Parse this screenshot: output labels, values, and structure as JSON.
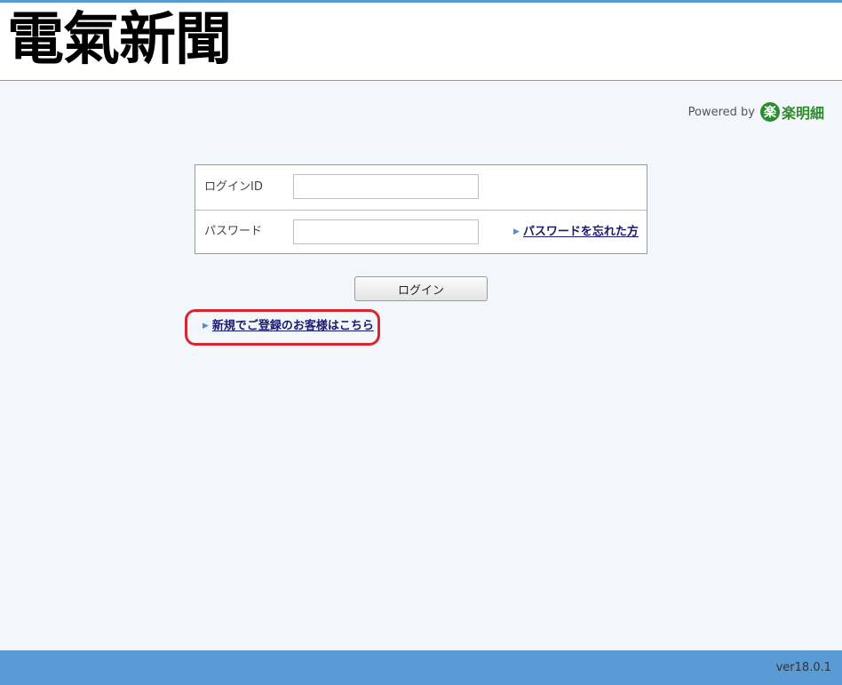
{
  "header": {
    "logo_text": "電氣新聞"
  },
  "powered": {
    "label": "Powered by",
    "brand_icon_char": "楽",
    "brand_icon": "rakumeisai-logo-icon",
    "brand_name": "楽明細"
  },
  "login_form": {
    "id_label": "ログインID",
    "id_value": "",
    "password_label": "パスワード",
    "password_value": "",
    "forgot_link": "パスワードを忘れた方"
  },
  "login_button": "ログイン",
  "register_link": "新規でご登録のお客様はこちら",
  "footer": {
    "version": "ver18.0.1"
  },
  "colors": {
    "accent": "#5b9bd5",
    "brand_green": "#2e8b2e",
    "highlight_red": "#d9262e",
    "background": "#f3f7fb"
  }
}
